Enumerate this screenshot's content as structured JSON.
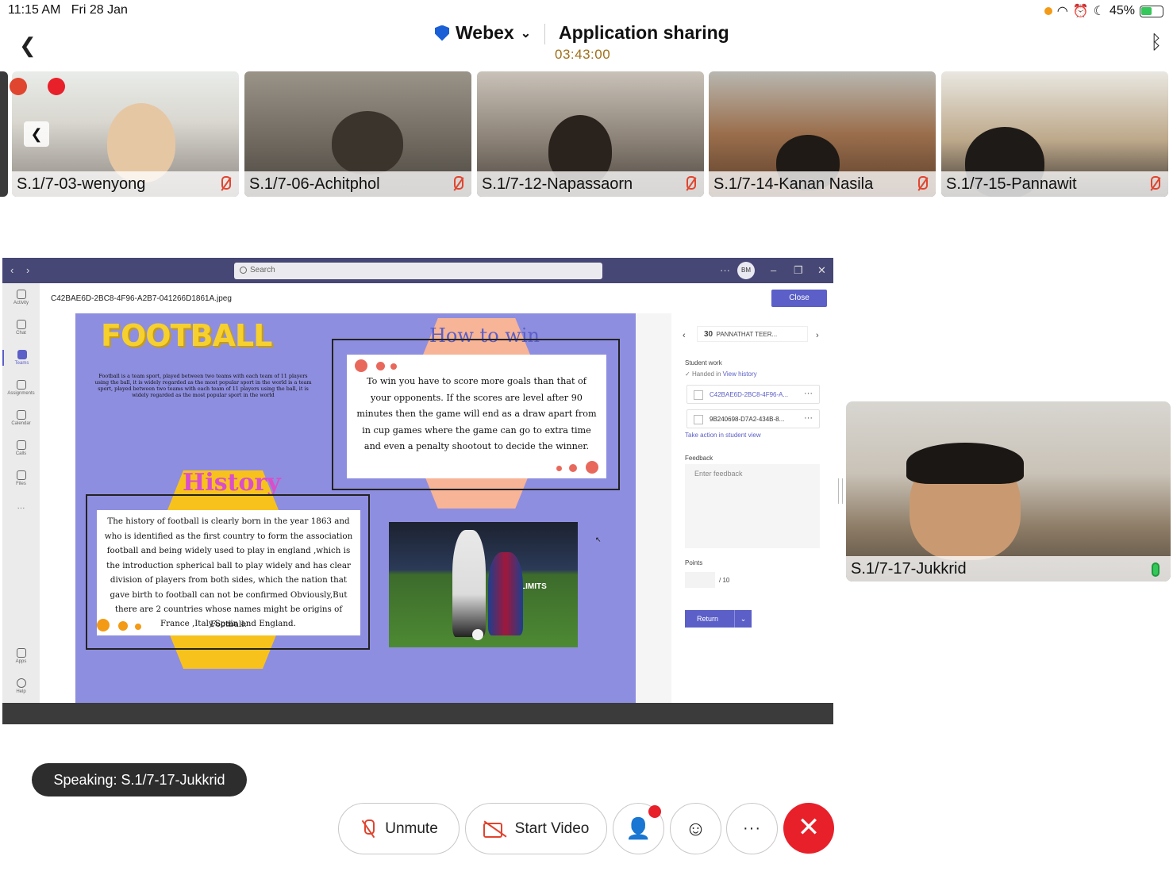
{
  "status_bar": {
    "time": "11:15 AM",
    "date": "Fri 28 Jan",
    "battery": "45%"
  },
  "header": {
    "brand": "Webex",
    "title": "Application sharing",
    "timer": "03:43:00"
  },
  "participants": [
    {
      "name": "S.1/7-03-wenyong",
      "muted": true
    },
    {
      "name": "S.1/7-06-Achitphol",
      "muted": true
    },
    {
      "name": "S.1/7-12-Napassaorn",
      "muted": true
    },
    {
      "name": "S.1/7-14-Kanan Nasila",
      "muted": true
    },
    {
      "name": "S.1/7-15-Pannawit",
      "muted": true
    }
  ],
  "shared_app": {
    "search_placeholder": "Search",
    "avatar_initials": "BM",
    "rail": [
      "Activity",
      "Chat",
      "Teams",
      "Assignments",
      "Calendar",
      "Calls",
      "Files",
      "Apps",
      "Help"
    ],
    "file_name": "C42BAE6D-2BC8-4F96-A2B7-041266D1861A.jpeg",
    "close_label": "Close",
    "slide": {
      "title": "FOOTBALL",
      "intro": "Football is a team sport, played between two teams with each team of 11 players using the ball, it is widely regarded as the most popular sport in the world is a team sport, played between two teams with each team of 11 players using the ball, it is widely regarded as the most popular sport in the world",
      "how_to_win_title": "How to win",
      "how_to_win_text": "To win you have to score more goals than that of your opponents. If the scores are level after 90 minutes then the game will end as a draw apart from in cup games where the game can go to extra time and even a penalty shootout to decide the winner.",
      "history_title": "History",
      "history_text": "The history of football is clearly born in the year 1863 and who is identified as the first country to form the association football and being widely used to play in england ,which is the introduction spherical ball to play widely and has clear division of players from both sides, which the nation that gave birth to football can not be confirmed Obviously,But there are 2 countries whose names might be origins of Football:",
      "history_countries": "France ,Italy,Spain and England.",
      "photo_banner": "LIMITS"
    },
    "grading": {
      "count": "30",
      "student": "PANNATHAT TEER...",
      "student_work_label": "Student work",
      "handed_in": "Handed in",
      "view_history": "View history",
      "files": [
        "C42BAE6D-2BC8-4F96-A...",
        "9B240698-D7A2-434B-8..."
      ],
      "take_action": "Take action in student view",
      "feedback_label": "Feedback",
      "feedback_placeholder": "Enter feedback",
      "points_label": "Points",
      "points_max": "/ 10",
      "return_label": "Return"
    }
  },
  "self_view": {
    "name": "S.1/7-17-Jukkrid"
  },
  "speaking": "Speaking: S.1/7-17-Jukkrid",
  "controls": {
    "unmute": "Unmute",
    "start_video": "Start Video",
    "more": "···"
  },
  "colors": {
    "teams_purple": "#464775",
    "accent": "#5b5fc7",
    "end_call": "#e8202a",
    "muted_red": "#e0452f",
    "slide_bg": "#8e8ee0"
  }
}
